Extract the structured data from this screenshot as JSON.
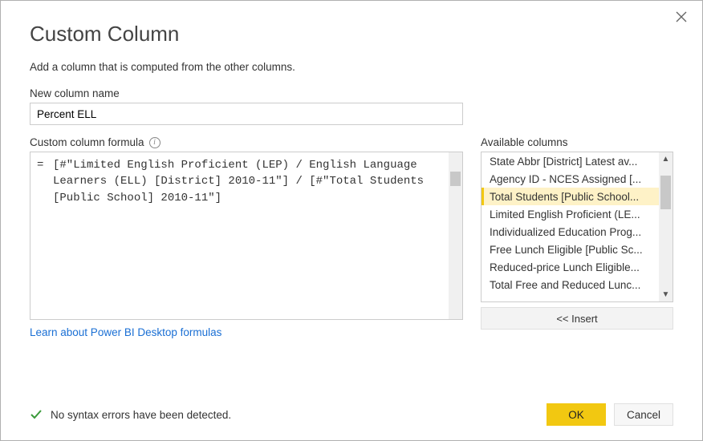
{
  "dialog": {
    "title": "Custom Column",
    "subtitle": "Add a column that is computed from the other columns."
  },
  "newColumn": {
    "label": "New column name",
    "value": "Percent ELL"
  },
  "formula": {
    "label": "Custom column formula",
    "prefix": "=",
    "text": "[#\"Limited English Proficient (LEP) / English Language Learners (ELL) [District] 2010-11\"] / [#\"Total Students [Public School] 2010-11\"]"
  },
  "available": {
    "label": "Available columns",
    "items": [
      "State Abbr [District] Latest av...",
      "Agency ID - NCES Assigned [...",
      "Total Students [Public School...",
      "Limited English Proficient (LE...",
      "Individualized Education Prog...",
      "Free Lunch Eligible [Public Sc...",
      "Reduced-price Lunch Eligible...",
      "Total Free and Reduced Lunc..."
    ],
    "selectedIndex": 2,
    "insertLabel": "<< Insert"
  },
  "learnLink": "Learn about Power BI Desktop formulas",
  "status": {
    "text": "No syntax errors have been detected."
  },
  "buttons": {
    "ok": "OK",
    "cancel": "Cancel"
  }
}
